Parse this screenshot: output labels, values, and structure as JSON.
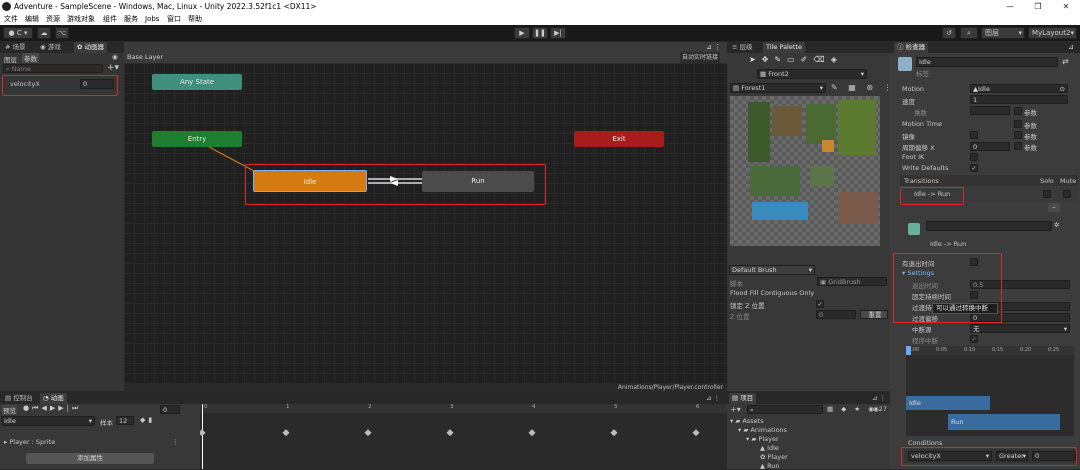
{
  "window": {
    "title": "Adventure - SampleScene - Windows, Mac, Linux - Unity 2022.3.52f1c1 <DX11>"
  },
  "menu": [
    "文件",
    "编辑",
    "资源",
    "游戏对象",
    "组件",
    "服务",
    "Jobs",
    "窗口",
    "帮助"
  ],
  "toolbar": {
    "account": "C",
    "layout": "MyLayout2",
    "layers": "图层"
  },
  "left": {
    "tabs": [
      "场景",
      "游戏",
      "动画器"
    ],
    "subtabs": [
      "图层",
      "参数"
    ],
    "search_placeholder": "Name",
    "param": {
      "name": "velocityX",
      "value": "0"
    }
  },
  "animator": {
    "layer": "Base Layer",
    "live_link": "自动实时链接",
    "nodes": {
      "any": "Any State",
      "entry": "Entry",
      "exit": "Exit",
      "idle": "Idle",
      "run": "Run"
    },
    "path": "Animations/Player/Player.controller"
  },
  "palette": {
    "tabs": [
      "层级",
      "Tile Palette"
    ],
    "palette_name": "Front2",
    "tilemap": "Forest1",
    "brush": "Default Brush",
    "labels": {
      "script": "脚本",
      "grid_brush": "GridBrush",
      "flood": "Flood Fill Contiguous Only",
      "lock_z": "锁定 Z 位置",
      "z_pos": "Z 位置",
      "z_value": "0",
      "reset": "重置"
    }
  },
  "inspector": {
    "tab": "检查器",
    "name": "Idle",
    "tag": "标签",
    "rows": [
      {
        "label": "Motion",
        "value": "Idle"
      },
      {
        "label": "速度",
        "value": "1"
      },
      {
        "label": "乘数",
        "value": "",
        "extra": "参数"
      },
      {
        "label": "Motion Time",
        "value": "",
        "extra": "参数"
      },
      {
        "label": "镜像",
        "value": "",
        "extra": "参数"
      },
      {
        "label": "周期偏移 X",
        "value": "0",
        "extra": "参数"
      },
      {
        "label": "Foot IK",
        "value": ""
      },
      {
        "label": "Write Defaults",
        "value": "✓"
      }
    ],
    "transitions": "Transitions",
    "solo": "Solo",
    "mute": "Mute",
    "transition_item": "Idle -> Run",
    "transition_title": "Idle -> Run",
    "has_exit_time": "有退出时间",
    "settings": "Settings",
    "settings_rows": [
      {
        "label": "退出时间",
        "value": "0.5"
      },
      {
        "label": "固定持续时间",
        "value": ""
      },
      {
        "label": "过渡持续",
        "value": "0"
      },
      {
        "label": "过渡偏移",
        "value": "0"
      }
    ],
    "tooltip": "可以通过转换中断",
    "interrupt_source": "中断源",
    "interrupt_value": "无",
    "ordered": "程序中断",
    "timeline_ticks": [
      "0:00",
      "0:05",
      "0:10",
      "0:15",
      "0:20",
      "0:25"
    ],
    "clip_idle": "Idle",
    "clip_run": "Run",
    "conditions": "Conditions",
    "condition": {
      "param": "velocityX",
      "op": "Greater",
      "value": "0"
    }
  },
  "bottom": {
    "tabs": [
      "控制台",
      "动画"
    ],
    "preview": "预览",
    "clip": "Idle",
    "samples_label": "样本",
    "samples": "12",
    "frame": "0",
    "track": "Player : Sprite",
    "add_property": "添加属性",
    "ruler": [
      "0",
      "1",
      "2",
      "3",
      "4",
      "5",
      "6",
      "7",
      "8",
      "9"
    ]
  },
  "project": {
    "tab": "项目",
    "count": "27",
    "tree": [
      "Assets",
      "Animations",
      "Player",
      "Idle",
      "Player",
      "Run"
    ]
  }
}
